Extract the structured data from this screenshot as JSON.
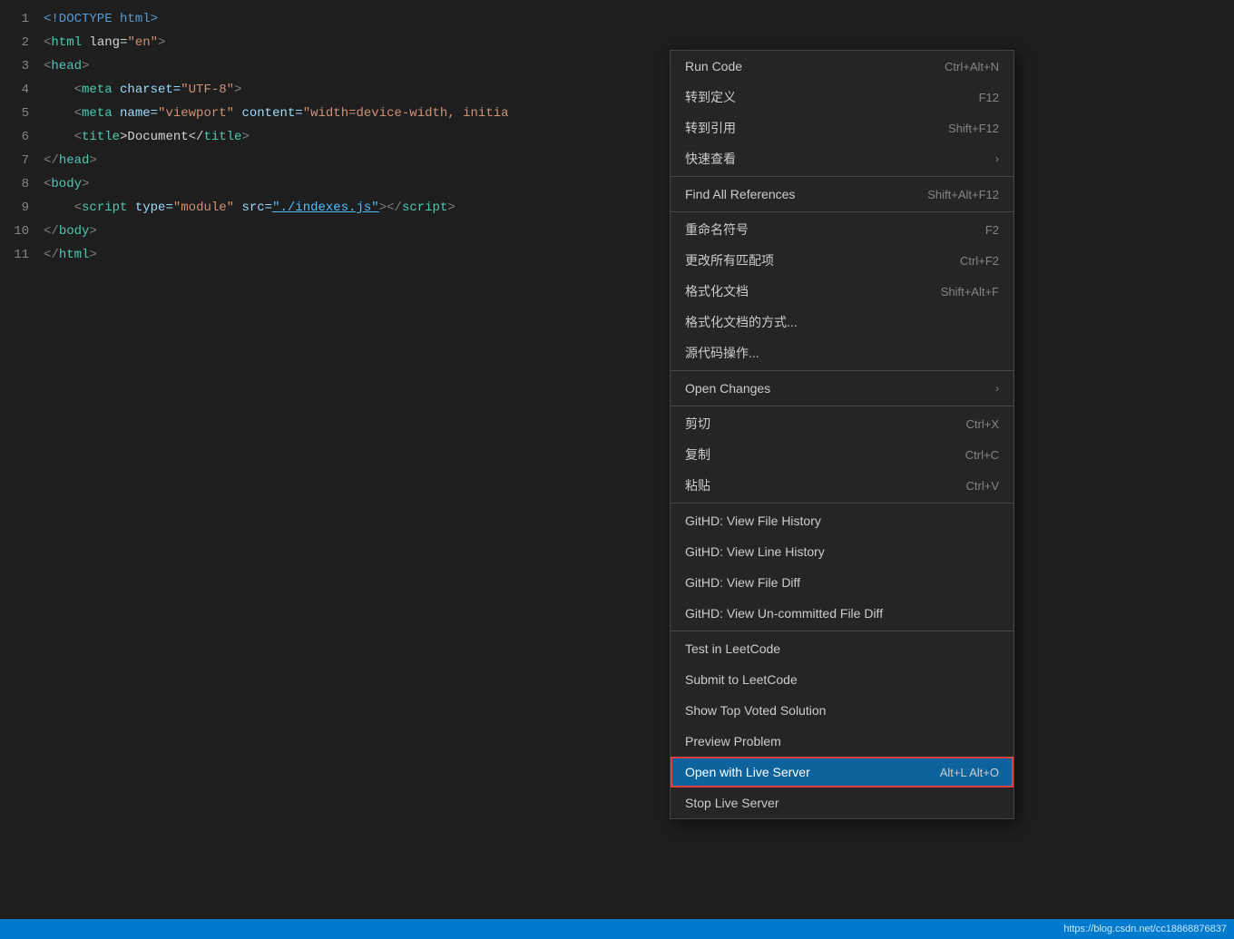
{
  "editor": {
    "background": "#1e1e1e",
    "lines": [
      {
        "num": 1,
        "tokens": [
          {
            "text": "<!DOCTYPE html>",
            "class": "kw"
          }
        ]
      },
      {
        "num": 2,
        "tokens": [
          {
            "text": "<",
            "class": "punct"
          },
          {
            "text": "html",
            "class": "tag"
          },
          {
            "text": " lang=",
            "class": "text-white"
          },
          {
            "text": "\"en\"",
            "class": "str"
          },
          {
            "text": ">",
            "class": "punct"
          }
        ]
      },
      {
        "num": 3,
        "tokens": [
          {
            "text": "<",
            "class": "punct"
          },
          {
            "text": "head",
            "class": "tag"
          },
          {
            "text": ">",
            "class": "punct"
          }
        ]
      },
      {
        "num": 4,
        "tokens": [
          {
            "text": "    <",
            "class": "punct"
          },
          {
            "text": "meta",
            "class": "tag"
          },
          {
            "text": " charset=",
            "class": "attr"
          },
          {
            "text": "\"UTF-8\"",
            "class": "str"
          },
          {
            "text": ">",
            "class": "punct"
          }
        ]
      },
      {
        "num": 5,
        "tokens": [
          {
            "text": "    <",
            "class": "punct"
          },
          {
            "text": "meta",
            "class": "tag"
          },
          {
            "text": " name=",
            "class": "attr"
          },
          {
            "text": "\"viewport\"",
            "class": "str"
          },
          {
            "text": " content=",
            "class": "attr"
          },
          {
            "text": "\"width=device-width, initia",
            "class": "str"
          }
        ]
      },
      {
        "num": 6,
        "tokens": [
          {
            "text": "    <",
            "class": "punct"
          },
          {
            "text": "title",
            "class": "tag"
          },
          {
            "text": ">Document</",
            "class": "text-white"
          },
          {
            "text": "title",
            "class": "tag"
          },
          {
            "text": ">",
            "class": "punct"
          }
        ]
      },
      {
        "num": 7,
        "tokens": [
          {
            "text": "</",
            "class": "punct"
          },
          {
            "text": "head",
            "class": "tag"
          },
          {
            "text": ">",
            "class": "punct"
          }
        ]
      },
      {
        "num": 8,
        "tokens": [
          {
            "text": "<",
            "class": "punct"
          },
          {
            "text": "body",
            "class": "tag"
          },
          {
            "text": ">",
            "class": "punct"
          }
        ]
      },
      {
        "num": 9,
        "tokens": [
          {
            "text": "    <",
            "class": "punct"
          },
          {
            "text": "script",
            "class": "tag"
          },
          {
            "text": " type=",
            "class": "attr"
          },
          {
            "text": "\"module\"",
            "class": "str"
          },
          {
            "text": " src=",
            "class": "attr"
          },
          {
            "text": "\"./indexes.js\"",
            "class": "link"
          },
          {
            "text": "></",
            "class": "punct"
          },
          {
            "text": "script",
            "class": "tag"
          },
          {
            "text": ">",
            "class": "punct"
          }
        ]
      },
      {
        "num": 10,
        "tokens": [
          {
            "text": "</",
            "class": "punct"
          },
          {
            "text": "body",
            "class": "tag"
          },
          {
            "text": ">",
            "class": "punct"
          }
        ]
      },
      {
        "num": 11,
        "tokens": [
          {
            "text": "</",
            "class": "punct"
          },
          {
            "text": "html",
            "class": "tag"
          },
          {
            "text": ">",
            "class": "punct"
          }
        ]
      }
    ]
  },
  "context_menu": {
    "items": [
      {
        "id": "run-code",
        "label": "Run Code",
        "shortcut": "Ctrl+Alt+N",
        "type": "item",
        "arrow": false
      },
      {
        "id": "goto-def",
        "label": "转到定义",
        "shortcut": "F12",
        "type": "item",
        "arrow": false
      },
      {
        "id": "goto-ref",
        "label": "转到引用",
        "shortcut": "Shift+F12",
        "type": "item",
        "arrow": false
      },
      {
        "id": "quick-view",
        "label": "快速查看",
        "shortcut": "",
        "type": "item",
        "arrow": true
      },
      {
        "id": "sep1",
        "type": "separator"
      },
      {
        "id": "find-refs",
        "label": "Find All References",
        "shortcut": "Shift+Alt+F12",
        "type": "item",
        "arrow": false
      },
      {
        "id": "sep2",
        "type": "separator"
      },
      {
        "id": "rename",
        "label": "重命名符号",
        "shortcut": "F2",
        "type": "item",
        "arrow": false
      },
      {
        "id": "change-all",
        "label": "更改所有匹配项",
        "shortcut": "Ctrl+F2",
        "type": "item",
        "arrow": false
      },
      {
        "id": "format-doc",
        "label": "格式化文档",
        "shortcut": "Shift+Alt+F",
        "type": "item",
        "arrow": false
      },
      {
        "id": "format-doc-with",
        "label": "格式化文档的方式...",
        "shortcut": "",
        "type": "item",
        "arrow": false
      },
      {
        "id": "source-action",
        "label": "源代码操作...",
        "shortcut": "",
        "type": "item",
        "arrow": false
      },
      {
        "id": "sep3",
        "type": "separator"
      },
      {
        "id": "open-changes",
        "label": "Open Changes",
        "shortcut": "",
        "type": "item",
        "arrow": true
      },
      {
        "id": "sep4",
        "type": "separator"
      },
      {
        "id": "cut",
        "label": "剪切",
        "shortcut": "Ctrl+X",
        "type": "item",
        "arrow": false
      },
      {
        "id": "copy",
        "label": "复制",
        "shortcut": "Ctrl+C",
        "type": "item",
        "arrow": false
      },
      {
        "id": "paste",
        "label": "粘贴",
        "shortcut": "Ctrl+V",
        "type": "item",
        "arrow": false
      },
      {
        "id": "sep5",
        "type": "separator"
      },
      {
        "id": "githd-file-history",
        "label": "GitHD: View File History",
        "shortcut": "",
        "type": "item",
        "arrow": false
      },
      {
        "id": "githd-line-history",
        "label": "GitHD: View Line History",
        "shortcut": "",
        "type": "item",
        "arrow": false
      },
      {
        "id": "githd-file-diff",
        "label": "GitHD: View File Diff",
        "shortcut": "",
        "type": "item",
        "arrow": false
      },
      {
        "id": "githd-uncommitted",
        "label": "GitHD: View Un-committed File Diff",
        "shortcut": "",
        "type": "item",
        "arrow": false
      },
      {
        "id": "sep6",
        "type": "separator"
      },
      {
        "id": "test-leetcode",
        "label": "Test in LeetCode",
        "shortcut": "",
        "type": "item",
        "arrow": false
      },
      {
        "id": "submit-leetcode",
        "label": "Submit to LeetCode",
        "shortcut": "",
        "type": "item",
        "arrow": false
      },
      {
        "id": "show-top-voted",
        "label": "Show Top Voted Solution",
        "shortcut": "",
        "type": "item",
        "arrow": false
      },
      {
        "id": "preview-problem",
        "label": "Preview Problem",
        "shortcut": "",
        "type": "item",
        "arrow": false
      },
      {
        "id": "open-live-server",
        "label": "Open with Live Server",
        "shortcut": "Alt+L Alt+O",
        "type": "item",
        "arrow": false,
        "active": true
      },
      {
        "id": "stop-live-server",
        "label": "Stop Live Server",
        "shortcut": "",
        "type": "item",
        "arrow": false
      }
    ]
  },
  "status_bar": {
    "url": "https://blog.csdn.net/cc18868876837"
  }
}
